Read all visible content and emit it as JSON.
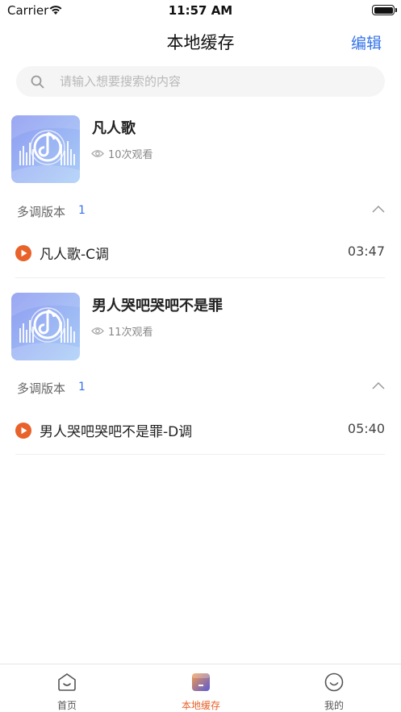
{
  "status_bar": {
    "carrier": "Carrier",
    "time": "11:57 AM"
  },
  "header": {
    "title": "本地缓存",
    "edit_label": "编辑"
  },
  "search": {
    "placeholder": "请输入想要搜索的内容",
    "value": ""
  },
  "songs": [
    {
      "title": "凡人歌",
      "views": "10次观看",
      "versions_label": "多调版本",
      "versions_count": "1",
      "tracks": [
        {
          "title": "凡人歌-C调",
          "duration": "03:47"
        }
      ]
    },
    {
      "title": "男人哭吧哭吧不是罪",
      "views": "11次观看",
      "versions_label": "多调版本",
      "versions_count": "1",
      "tracks": [
        {
          "title": "男人哭吧哭吧不是罪-D调",
          "duration": "05:40"
        }
      ]
    }
  ],
  "tabbar": {
    "items": [
      {
        "label": "首页",
        "icon": "home-icon"
      },
      {
        "label": "本地缓存",
        "icon": "local-cache-icon"
      },
      {
        "label": "我的",
        "icon": "profile-icon"
      }
    ],
    "active_index": 1
  },
  "colors": {
    "accent": "#3473e8",
    "active_tab": "#e8622a",
    "play": "#e8622a"
  }
}
